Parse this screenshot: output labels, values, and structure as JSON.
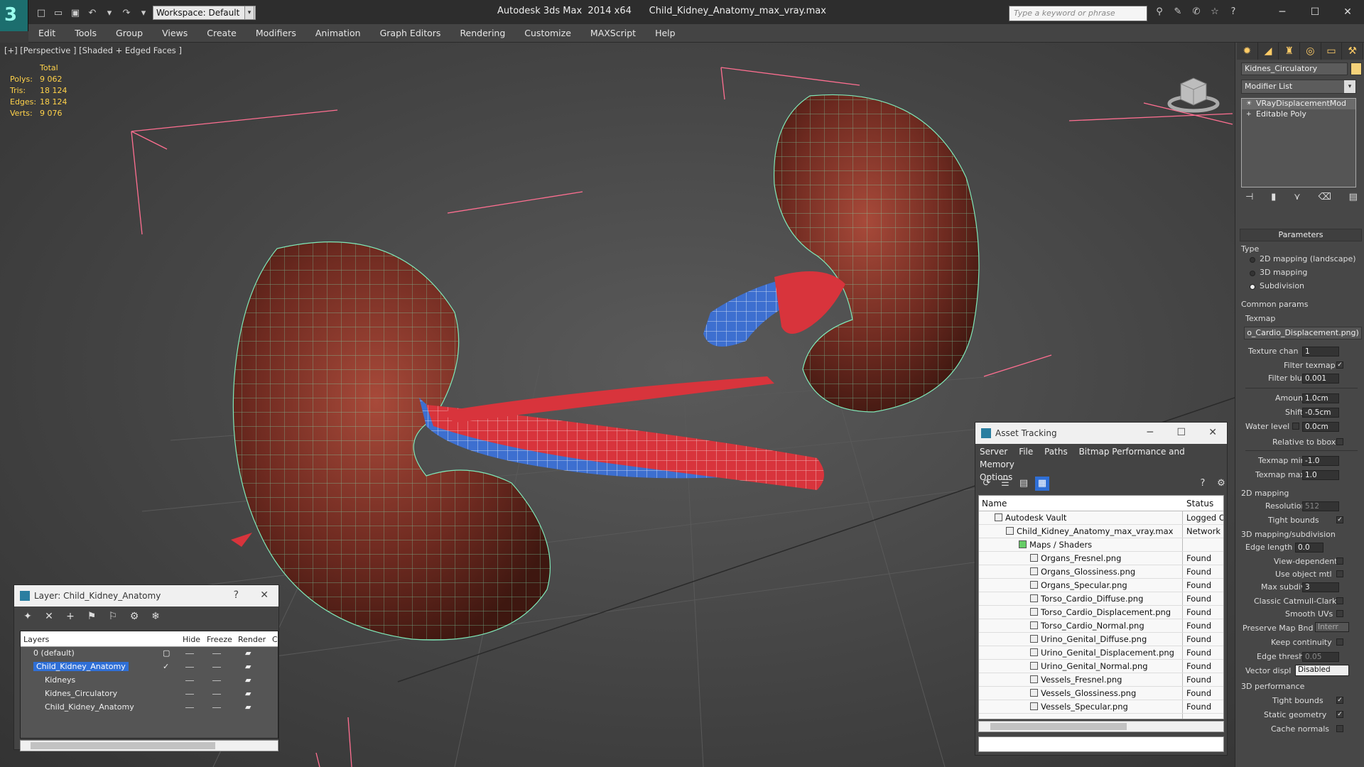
{
  "titlebar": {
    "app_title": "Autodesk 3ds Max  2014 x64      Child_Kidney_Anatomy_max_vray.max",
    "workspace_label": "Workspace: Default",
    "search_placeholder": "Type a keyword or phrase"
  },
  "menu": [
    "Edit",
    "Tools",
    "Group",
    "Views",
    "Create",
    "Modifiers",
    "Animation",
    "Graph Editors",
    "Rendering",
    "Customize",
    "MAXScript",
    "Help"
  ],
  "viewport": {
    "label": "[+] [Perspective ] [Shaded + Edged Faces ]",
    "stats_header": "Total",
    "stats": [
      {
        "key": "Polys:",
        "value": "9 062"
      },
      {
        "key": "Tris:",
        "value": "18 124"
      },
      {
        "key": "Edges:",
        "value": "18 124"
      },
      {
        "key": "Verts:",
        "value": "9 076"
      }
    ]
  },
  "command_panel": {
    "object_name": "Kidnes_Circulatory",
    "object_color": "#f5d27a",
    "modifier_list": "Modifier List",
    "stack": [
      "VRayDisplacementMod",
      "Editable Poly"
    ],
    "parameters_title": "Parameters",
    "type_label": "Type",
    "type_options": [
      {
        "label": "2D mapping (landscape)",
        "selected": false
      },
      {
        "label": "3D mapping",
        "selected": false
      },
      {
        "label": "Subdivision",
        "selected": true
      }
    ],
    "common_params": "Common params",
    "texmap_label": "Texmap",
    "texmap_value": "o_Cardio_Displacement.png)",
    "texture_chan_label": "Texture chan",
    "texture_chan_value": "1",
    "filter_texmap": "Filter texmap",
    "filter_blur_label": "Filter blur",
    "filter_blur_value": "0.001",
    "amount_label": "Amount",
    "amount_value": "1.0cm",
    "shift_label": "Shift",
    "shift_value": "-0.5cm",
    "water_level_label": "Water level",
    "water_level_value": "0.0cm",
    "relative_to_bbox": "Relative to bbox",
    "texmap_min_label": "Texmap min",
    "texmap_min_value": "-1.0",
    "texmap_max_label": "Texmap max",
    "texmap_max_value": "1.0",
    "mapping_2d": "2D mapping",
    "resolution_label": "Resolution",
    "resolution_value": "512",
    "tight_bounds": "Tight bounds",
    "mapping_3d": "3D mapping/subdivision",
    "edge_length_label": "Edge length",
    "edge_length_value": "0.0",
    "view_dependent": "View-dependent",
    "use_object_mtl": "Use object mtl",
    "max_subdivs_label": "Max subdivs",
    "max_subdivs_value": "3",
    "classic_catmull": "Classic Catmull-Clark",
    "smooth_uvs": "Smooth UVs",
    "preserve_map_bnd": "Preserve Map Bnd",
    "preserve_map_value": "Interr",
    "keep_continuity": "Keep continuity",
    "edge_thresh_label": "Edge thresh",
    "edge_thresh_value": "0.05",
    "vector_displ_label": "Vector displ",
    "vector_displ_value": "Disabled",
    "perf_3d": "3D performance",
    "tight_bounds2": "Tight bounds",
    "static_geometry": "Static geometry",
    "cache_normals": "Cache normals"
  },
  "layer_dialog": {
    "title": "Layer: Child_Kidney_Anatomy",
    "help": "?",
    "columns": [
      "Layers",
      "Hide",
      "Freeze",
      "Render",
      "C"
    ],
    "rows": [
      {
        "name": "0 (default)",
        "indent": 1,
        "selected": false
      },
      {
        "name": "Child_Kidney_Anatomy",
        "indent": 1,
        "selected": true
      },
      {
        "name": "Kidneys",
        "indent": 2,
        "selected": false
      },
      {
        "name": "Kidnes_Circulatory",
        "indent": 2,
        "selected": false
      },
      {
        "name": "Child_Kidney_Anatomy",
        "indent": 2,
        "selected": false
      }
    ]
  },
  "asset_tracking": {
    "title": "Asset Tracking",
    "menu": [
      "Server",
      "File",
      "Paths",
      "Bitmap Performance and Memory"
    ],
    "menu2": "Options",
    "columns": [
      "Name",
      "Status"
    ],
    "rows": [
      {
        "name": "Autodesk Vault",
        "status": "Logged O",
        "indent": 1
      },
      {
        "name": "Child_Kidney_Anatomy_max_vray.max",
        "status": "Network F",
        "indent": 2
      },
      {
        "name": "Maps / Shaders",
        "status": "",
        "indent": 3
      },
      {
        "name": "Organs_Fresnel.png",
        "status": "Found",
        "indent": 4
      },
      {
        "name": "Organs_Glossiness.png",
        "status": "Found",
        "indent": 4
      },
      {
        "name": "Organs_Specular.png",
        "status": "Found",
        "indent": 4
      },
      {
        "name": "Torso_Cardio_Diffuse.png",
        "status": "Found",
        "indent": 4
      },
      {
        "name": "Torso_Cardio_Displacement.png",
        "status": "Found",
        "indent": 4
      },
      {
        "name": "Torso_Cardio_Normal.png",
        "status": "Found",
        "indent": 4
      },
      {
        "name": "Urino_Genital_Diffuse.png",
        "status": "Found",
        "indent": 4
      },
      {
        "name": "Urino_Genital_Displacement.png",
        "status": "Found",
        "indent": 4
      },
      {
        "name": "Urino_Genital_Normal.png",
        "status": "Found",
        "indent": 4
      },
      {
        "name": "Vessels_Fresnel.png",
        "status": "Found",
        "indent": 4
      },
      {
        "name": "Vessels_Glossiness.png",
        "status": "Found",
        "indent": 4
      },
      {
        "name": "Vessels_Specular.png",
        "status": "Found",
        "indent": 4
      }
    ]
  }
}
